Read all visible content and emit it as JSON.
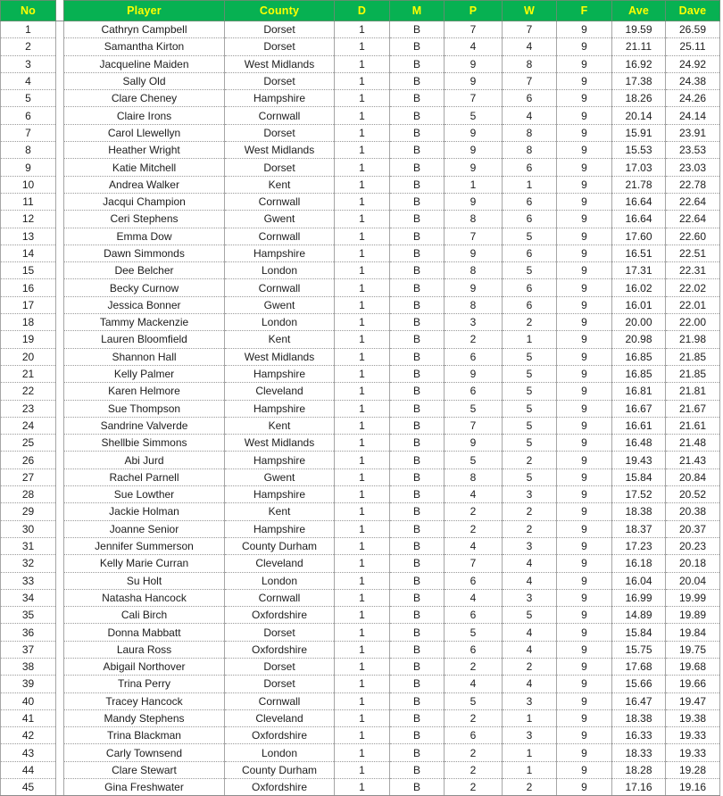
{
  "theme": {
    "header_bg": "#07b152",
    "header_text": "#ffff00",
    "header_border": "#5f8f6f",
    "body_text": "#1d1d1d",
    "grid_line": "#a6a6a6",
    "row_dotted": "#9a9a9a",
    "page_bg": "#ffffff"
  },
  "table": {
    "columns": [
      {
        "key": "no",
        "label": "No"
      },
      {
        "key": "player",
        "label": "Player"
      },
      {
        "key": "county",
        "label": "County"
      },
      {
        "key": "d",
        "label": "D"
      },
      {
        "key": "m",
        "label": "M"
      },
      {
        "key": "p",
        "label": "P"
      },
      {
        "key": "w",
        "label": "W"
      },
      {
        "key": "f",
        "label": "F"
      },
      {
        "key": "ave",
        "label": "Ave"
      },
      {
        "key": "dave",
        "label": "Dave"
      }
    ],
    "rows": [
      {
        "no": "1",
        "player": "Cathryn Campbell",
        "county": "Dorset",
        "d": "1",
        "m": "B",
        "p": "7",
        "w": "7",
        "f": "9",
        "ave": "19.59",
        "dave": "26.59"
      },
      {
        "no": "2",
        "player": "Samantha Kirton",
        "county": "Dorset",
        "d": "1",
        "m": "B",
        "p": "4",
        "w": "4",
        "f": "9",
        "ave": "21.11",
        "dave": "25.11"
      },
      {
        "no": "3",
        "player": "Jacqueline Maiden",
        "county": "West Midlands",
        "d": "1",
        "m": "B",
        "p": "9",
        "w": "8",
        "f": "9",
        "ave": "16.92",
        "dave": "24.92"
      },
      {
        "no": "4",
        "player": "Sally Old",
        "county": "Dorset",
        "d": "1",
        "m": "B",
        "p": "9",
        "w": "7",
        "f": "9",
        "ave": "17.38",
        "dave": "24.38"
      },
      {
        "no": "5",
        "player": "Clare Cheney",
        "county": "Hampshire",
        "d": "1",
        "m": "B",
        "p": "7",
        "w": "6",
        "f": "9",
        "ave": "18.26",
        "dave": "24.26"
      },
      {
        "no": "6",
        "player": "Claire Irons",
        "county": "Cornwall",
        "d": "1",
        "m": "B",
        "p": "5",
        "w": "4",
        "f": "9",
        "ave": "20.14",
        "dave": "24.14"
      },
      {
        "no": "7",
        "player": "Carol Llewellyn",
        "county": "Dorset",
        "d": "1",
        "m": "B",
        "p": "9",
        "w": "8",
        "f": "9",
        "ave": "15.91",
        "dave": "23.91"
      },
      {
        "no": "8",
        "player": "Heather Wright",
        "county": "West Midlands",
        "d": "1",
        "m": "B",
        "p": "9",
        "w": "8",
        "f": "9",
        "ave": "15.53",
        "dave": "23.53"
      },
      {
        "no": "9",
        "player": "Katie Mitchell",
        "county": "Dorset",
        "d": "1",
        "m": "B",
        "p": "9",
        "w": "6",
        "f": "9",
        "ave": "17.03",
        "dave": "23.03"
      },
      {
        "no": "10",
        "player": "Andrea Walker",
        "county": "Kent",
        "d": "1",
        "m": "B",
        "p": "1",
        "w": "1",
        "f": "9",
        "ave": "21.78",
        "dave": "22.78"
      },
      {
        "no": "11",
        "player": "Jacqui Champion",
        "county": "Cornwall",
        "d": "1",
        "m": "B",
        "p": "9",
        "w": "6",
        "f": "9",
        "ave": "16.64",
        "dave": "22.64"
      },
      {
        "no": "12",
        "player": "Ceri Stephens",
        "county": "Gwent",
        "d": "1",
        "m": "B",
        "p": "8",
        "w": "6",
        "f": "9",
        "ave": "16.64",
        "dave": "22.64"
      },
      {
        "no": "13",
        "player": "Emma Dow",
        "county": "Cornwall",
        "d": "1",
        "m": "B",
        "p": "7",
        "w": "5",
        "f": "9",
        "ave": "17.60",
        "dave": "22.60"
      },
      {
        "no": "14",
        "player": "Dawn Simmonds",
        "county": "Hampshire",
        "d": "1",
        "m": "B",
        "p": "9",
        "w": "6",
        "f": "9",
        "ave": "16.51",
        "dave": "22.51"
      },
      {
        "no": "15",
        "player": "Dee Belcher",
        "county": "London",
        "d": "1",
        "m": "B",
        "p": "8",
        "w": "5",
        "f": "9",
        "ave": "17.31",
        "dave": "22.31"
      },
      {
        "no": "16",
        "player": "Becky Curnow",
        "county": "Cornwall",
        "d": "1",
        "m": "B",
        "p": "9",
        "w": "6",
        "f": "9",
        "ave": "16.02",
        "dave": "22.02"
      },
      {
        "no": "17",
        "player": "Jessica Bonner",
        "county": "Gwent",
        "d": "1",
        "m": "B",
        "p": "8",
        "w": "6",
        "f": "9",
        "ave": "16.01",
        "dave": "22.01"
      },
      {
        "no": "18",
        "player": "Tammy Mackenzie",
        "county": "London",
        "d": "1",
        "m": "B",
        "p": "3",
        "w": "2",
        "f": "9",
        "ave": "20.00",
        "dave": "22.00"
      },
      {
        "no": "19",
        "player": "Lauren Bloomfield",
        "county": "Kent",
        "d": "1",
        "m": "B",
        "p": "2",
        "w": "1",
        "f": "9",
        "ave": "20.98",
        "dave": "21.98"
      },
      {
        "no": "20",
        "player": "Shannon Hall",
        "county": "West Midlands",
        "d": "1",
        "m": "B",
        "p": "6",
        "w": "5",
        "f": "9",
        "ave": "16.85",
        "dave": "21.85"
      },
      {
        "no": "21",
        "player": "Kelly Palmer",
        "county": "Hampshire",
        "d": "1",
        "m": "B",
        "p": "9",
        "w": "5",
        "f": "9",
        "ave": "16.85",
        "dave": "21.85"
      },
      {
        "no": "22",
        "player": "Karen Helmore",
        "county": "Cleveland",
        "d": "1",
        "m": "B",
        "p": "6",
        "w": "5",
        "f": "9",
        "ave": "16.81",
        "dave": "21.81"
      },
      {
        "no": "23",
        "player": "Sue Thompson",
        "county": "Hampshire",
        "d": "1",
        "m": "B",
        "p": "5",
        "w": "5",
        "f": "9",
        "ave": "16.67",
        "dave": "21.67"
      },
      {
        "no": "24",
        "player": "Sandrine Valverde",
        "county": "Kent",
        "d": "1",
        "m": "B",
        "p": "7",
        "w": "5",
        "f": "9",
        "ave": "16.61",
        "dave": "21.61"
      },
      {
        "no": "25",
        "player": "Shellbie Simmons",
        "county": "West Midlands",
        "d": "1",
        "m": "B",
        "p": "9",
        "w": "5",
        "f": "9",
        "ave": "16.48",
        "dave": "21.48"
      },
      {
        "no": "26",
        "player": "Abi Jurd",
        "county": "Hampshire",
        "d": "1",
        "m": "B",
        "p": "5",
        "w": "2",
        "f": "9",
        "ave": "19.43",
        "dave": "21.43"
      },
      {
        "no": "27",
        "player": "Rachel Parnell",
        "county": "Gwent",
        "d": "1",
        "m": "B",
        "p": "8",
        "w": "5",
        "f": "9",
        "ave": "15.84",
        "dave": "20.84"
      },
      {
        "no": "28",
        "player": "Sue Lowther",
        "county": "Hampshire",
        "d": "1",
        "m": "B",
        "p": "4",
        "w": "3",
        "f": "9",
        "ave": "17.52",
        "dave": "20.52"
      },
      {
        "no": "29",
        "player": "Jackie Holman",
        "county": "Kent",
        "d": "1",
        "m": "B",
        "p": "2",
        "w": "2",
        "f": "9",
        "ave": "18.38",
        "dave": "20.38"
      },
      {
        "no": "30",
        "player": "Joanne Senior",
        "county": "Hampshire",
        "d": "1",
        "m": "B",
        "p": "2",
        "w": "2",
        "f": "9",
        "ave": "18.37",
        "dave": "20.37"
      },
      {
        "no": "31",
        "player": "Jennifer Summerson",
        "county": "County Durham",
        "d": "1",
        "m": "B",
        "p": "4",
        "w": "3",
        "f": "9",
        "ave": "17.23",
        "dave": "20.23"
      },
      {
        "no": "32",
        "player": "Kelly Marie Curran",
        "county": "Cleveland",
        "d": "1",
        "m": "B",
        "p": "7",
        "w": "4",
        "f": "9",
        "ave": "16.18",
        "dave": "20.18"
      },
      {
        "no": "33",
        "player": "Su Holt",
        "county": "London",
        "d": "1",
        "m": "B",
        "p": "6",
        "w": "4",
        "f": "9",
        "ave": "16.04",
        "dave": "20.04"
      },
      {
        "no": "34",
        "player": "Natasha Hancock",
        "county": "Cornwall",
        "d": "1",
        "m": "B",
        "p": "4",
        "w": "3",
        "f": "9",
        "ave": "16.99",
        "dave": "19.99"
      },
      {
        "no": "35",
        "player": "Cali Birch",
        "county": "Oxfordshire",
        "d": "1",
        "m": "B",
        "p": "6",
        "w": "5",
        "f": "9",
        "ave": "14.89",
        "dave": "19.89"
      },
      {
        "no": "36",
        "player": "Donna Mabbatt",
        "county": "Dorset",
        "d": "1",
        "m": "B",
        "p": "5",
        "w": "4",
        "f": "9",
        "ave": "15.84",
        "dave": "19.84"
      },
      {
        "no": "37",
        "player": "Laura Ross",
        "county": "Oxfordshire",
        "d": "1",
        "m": "B",
        "p": "6",
        "w": "4",
        "f": "9",
        "ave": "15.75",
        "dave": "19.75"
      },
      {
        "no": "38",
        "player": "Abigail Northover",
        "county": "Dorset",
        "d": "1",
        "m": "B",
        "p": "2",
        "w": "2",
        "f": "9",
        "ave": "17.68",
        "dave": "19.68"
      },
      {
        "no": "39",
        "player": "Trina Perry",
        "county": "Dorset",
        "d": "1",
        "m": "B",
        "p": "4",
        "w": "4",
        "f": "9",
        "ave": "15.66",
        "dave": "19.66"
      },
      {
        "no": "40",
        "player": "Tracey Hancock",
        "county": "Cornwall",
        "d": "1",
        "m": "B",
        "p": "5",
        "w": "3",
        "f": "9",
        "ave": "16.47",
        "dave": "19.47"
      },
      {
        "no": "41",
        "player": "Mandy Stephens",
        "county": "Cleveland",
        "d": "1",
        "m": "B",
        "p": "2",
        "w": "1",
        "f": "9",
        "ave": "18.38",
        "dave": "19.38"
      },
      {
        "no": "42",
        "player": "Trina Blackman",
        "county": "Oxfordshire",
        "d": "1",
        "m": "B",
        "p": "6",
        "w": "3",
        "f": "9",
        "ave": "16.33",
        "dave": "19.33"
      },
      {
        "no": "43",
        "player": "Carly Townsend",
        "county": "London",
        "d": "1",
        "m": "B",
        "p": "2",
        "w": "1",
        "f": "9",
        "ave": "18.33",
        "dave": "19.33"
      },
      {
        "no": "44",
        "player": "Clare Stewart",
        "county": "County Durham",
        "d": "1",
        "m": "B",
        "p": "2",
        "w": "1",
        "f": "9",
        "ave": "18.28",
        "dave": "19.28"
      },
      {
        "no": "45",
        "player": "Gina Freshwater",
        "county": "Oxfordshire",
        "d": "1",
        "m": "B",
        "p": "2",
        "w": "2",
        "f": "9",
        "ave": "17.16",
        "dave": "19.16"
      }
    ]
  }
}
